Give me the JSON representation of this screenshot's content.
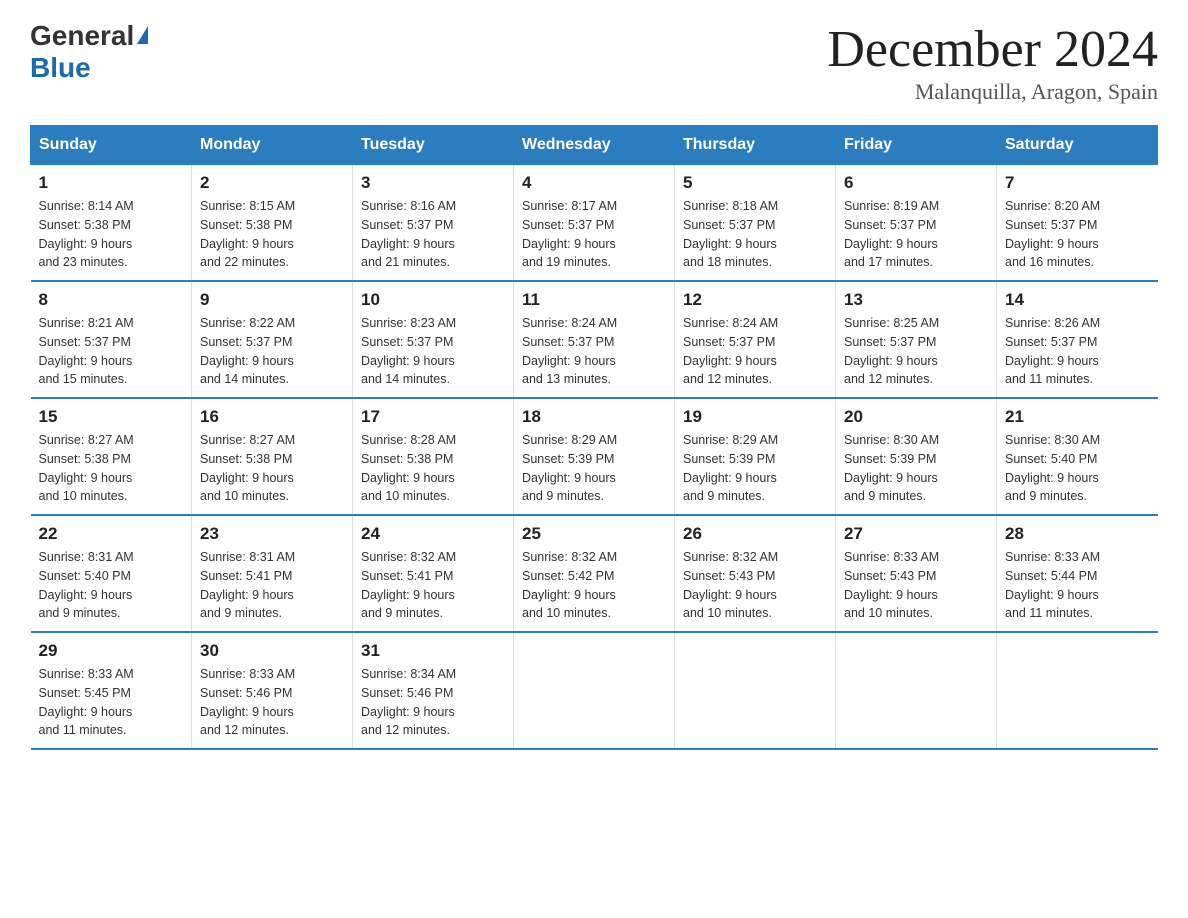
{
  "header": {
    "logo_general": "General",
    "logo_blue": "Blue",
    "month_title": "December 2024",
    "location": "Malanquilla, Aragon, Spain"
  },
  "columns": [
    "Sunday",
    "Monday",
    "Tuesday",
    "Wednesday",
    "Thursday",
    "Friday",
    "Saturday"
  ],
  "weeks": [
    [
      {
        "day": "1",
        "sunrise": "Sunrise: 8:14 AM",
        "sunset": "Sunset: 5:38 PM",
        "daylight": "Daylight: 9 hours",
        "minutes": "and 23 minutes."
      },
      {
        "day": "2",
        "sunrise": "Sunrise: 8:15 AM",
        "sunset": "Sunset: 5:38 PM",
        "daylight": "Daylight: 9 hours",
        "minutes": "and 22 minutes."
      },
      {
        "day": "3",
        "sunrise": "Sunrise: 8:16 AM",
        "sunset": "Sunset: 5:37 PM",
        "daylight": "Daylight: 9 hours",
        "minutes": "and 21 minutes."
      },
      {
        "day": "4",
        "sunrise": "Sunrise: 8:17 AM",
        "sunset": "Sunset: 5:37 PM",
        "daylight": "Daylight: 9 hours",
        "minutes": "and 19 minutes."
      },
      {
        "day": "5",
        "sunrise": "Sunrise: 8:18 AM",
        "sunset": "Sunset: 5:37 PM",
        "daylight": "Daylight: 9 hours",
        "minutes": "and 18 minutes."
      },
      {
        "day": "6",
        "sunrise": "Sunrise: 8:19 AM",
        "sunset": "Sunset: 5:37 PM",
        "daylight": "Daylight: 9 hours",
        "minutes": "and 17 minutes."
      },
      {
        "day": "7",
        "sunrise": "Sunrise: 8:20 AM",
        "sunset": "Sunset: 5:37 PM",
        "daylight": "Daylight: 9 hours",
        "minutes": "and 16 minutes."
      }
    ],
    [
      {
        "day": "8",
        "sunrise": "Sunrise: 8:21 AM",
        "sunset": "Sunset: 5:37 PM",
        "daylight": "Daylight: 9 hours",
        "minutes": "and 15 minutes."
      },
      {
        "day": "9",
        "sunrise": "Sunrise: 8:22 AM",
        "sunset": "Sunset: 5:37 PM",
        "daylight": "Daylight: 9 hours",
        "minutes": "and 14 minutes."
      },
      {
        "day": "10",
        "sunrise": "Sunrise: 8:23 AM",
        "sunset": "Sunset: 5:37 PM",
        "daylight": "Daylight: 9 hours",
        "minutes": "and 14 minutes."
      },
      {
        "day": "11",
        "sunrise": "Sunrise: 8:24 AM",
        "sunset": "Sunset: 5:37 PM",
        "daylight": "Daylight: 9 hours",
        "minutes": "and 13 minutes."
      },
      {
        "day": "12",
        "sunrise": "Sunrise: 8:24 AM",
        "sunset": "Sunset: 5:37 PM",
        "daylight": "Daylight: 9 hours",
        "minutes": "and 12 minutes."
      },
      {
        "day": "13",
        "sunrise": "Sunrise: 8:25 AM",
        "sunset": "Sunset: 5:37 PM",
        "daylight": "Daylight: 9 hours",
        "minutes": "and 12 minutes."
      },
      {
        "day": "14",
        "sunrise": "Sunrise: 8:26 AM",
        "sunset": "Sunset: 5:37 PM",
        "daylight": "Daylight: 9 hours",
        "minutes": "and 11 minutes."
      }
    ],
    [
      {
        "day": "15",
        "sunrise": "Sunrise: 8:27 AM",
        "sunset": "Sunset: 5:38 PM",
        "daylight": "Daylight: 9 hours",
        "minutes": "and 10 minutes."
      },
      {
        "day": "16",
        "sunrise": "Sunrise: 8:27 AM",
        "sunset": "Sunset: 5:38 PM",
        "daylight": "Daylight: 9 hours",
        "minutes": "and 10 minutes."
      },
      {
        "day": "17",
        "sunrise": "Sunrise: 8:28 AM",
        "sunset": "Sunset: 5:38 PM",
        "daylight": "Daylight: 9 hours",
        "minutes": "and 10 minutes."
      },
      {
        "day": "18",
        "sunrise": "Sunrise: 8:29 AM",
        "sunset": "Sunset: 5:39 PM",
        "daylight": "Daylight: 9 hours",
        "minutes": "and 9 minutes."
      },
      {
        "day": "19",
        "sunrise": "Sunrise: 8:29 AM",
        "sunset": "Sunset: 5:39 PM",
        "daylight": "Daylight: 9 hours",
        "minutes": "and 9 minutes."
      },
      {
        "day": "20",
        "sunrise": "Sunrise: 8:30 AM",
        "sunset": "Sunset: 5:39 PM",
        "daylight": "Daylight: 9 hours",
        "minutes": "and 9 minutes."
      },
      {
        "day": "21",
        "sunrise": "Sunrise: 8:30 AM",
        "sunset": "Sunset: 5:40 PM",
        "daylight": "Daylight: 9 hours",
        "minutes": "and 9 minutes."
      }
    ],
    [
      {
        "day": "22",
        "sunrise": "Sunrise: 8:31 AM",
        "sunset": "Sunset: 5:40 PM",
        "daylight": "Daylight: 9 hours",
        "minutes": "and 9 minutes."
      },
      {
        "day": "23",
        "sunrise": "Sunrise: 8:31 AM",
        "sunset": "Sunset: 5:41 PM",
        "daylight": "Daylight: 9 hours",
        "minutes": "and 9 minutes."
      },
      {
        "day": "24",
        "sunrise": "Sunrise: 8:32 AM",
        "sunset": "Sunset: 5:41 PM",
        "daylight": "Daylight: 9 hours",
        "minutes": "and 9 minutes."
      },
      {
        "day": "25",
        "sunrise": "Sunrise: 8:32 AM",
        "sunset": "Sunset: 5:42 PM",
        "daylight": "Daylight: 9 hours",
        "minutes": "and 10 minutes."
      },
      {
        "day": "26",
        "sunrise": "Sunrise: 8:32 AM",
        "sunset": "Sunset: 5:43 PM",
        "daylight": "Daylight: 9 hours",
        "minutes": "and 10 minutes."
      },
      {
        "day": "27",
        "sunrise": "Sunrise: 8:33 AM",
        "sunset": "Sunset: 5:43 PM",
        "daylight": "Daylight: 9 hours",
        "minutes": "and 10 minutes."
      },
      {
        "day": "28",
        "sunrise": "Sunrise: 8:33 AM",
        "sunset": "Sunset: 5:44 PM",
        "daylight": "Daylight: 9 hours",
        "minutes": "and 11 minutes."
      }
    ],
    [
      {
        "day": "29",
        "sunrise": "Sunrise: 8:33 AM",
        "sunset": "Sunset: 5:45 PM",
        "daylight": "Daylight: 9 hours",
        "minutes": "and 11 minutes."
      },
      {
        "day": "30",
        "sunrise": "Sunrise: 8:33 AM",
        "sunset": "Sunset: 5:46 PM",
        "daylight": "Daylight: 9 hours",
        "minutes": "and 12 minutes."
      },
      {
        "day": "31",
        "sunrise": "Sunrise: 8:34 AM",
        "sunset": "Sunset: 5:46 PM",
        "daylight": "Daylight: 9 hours",
        "minutes": "and 12 minutes."
      },
      null,
      null,
      null,
      null
    ]
  ]
}
